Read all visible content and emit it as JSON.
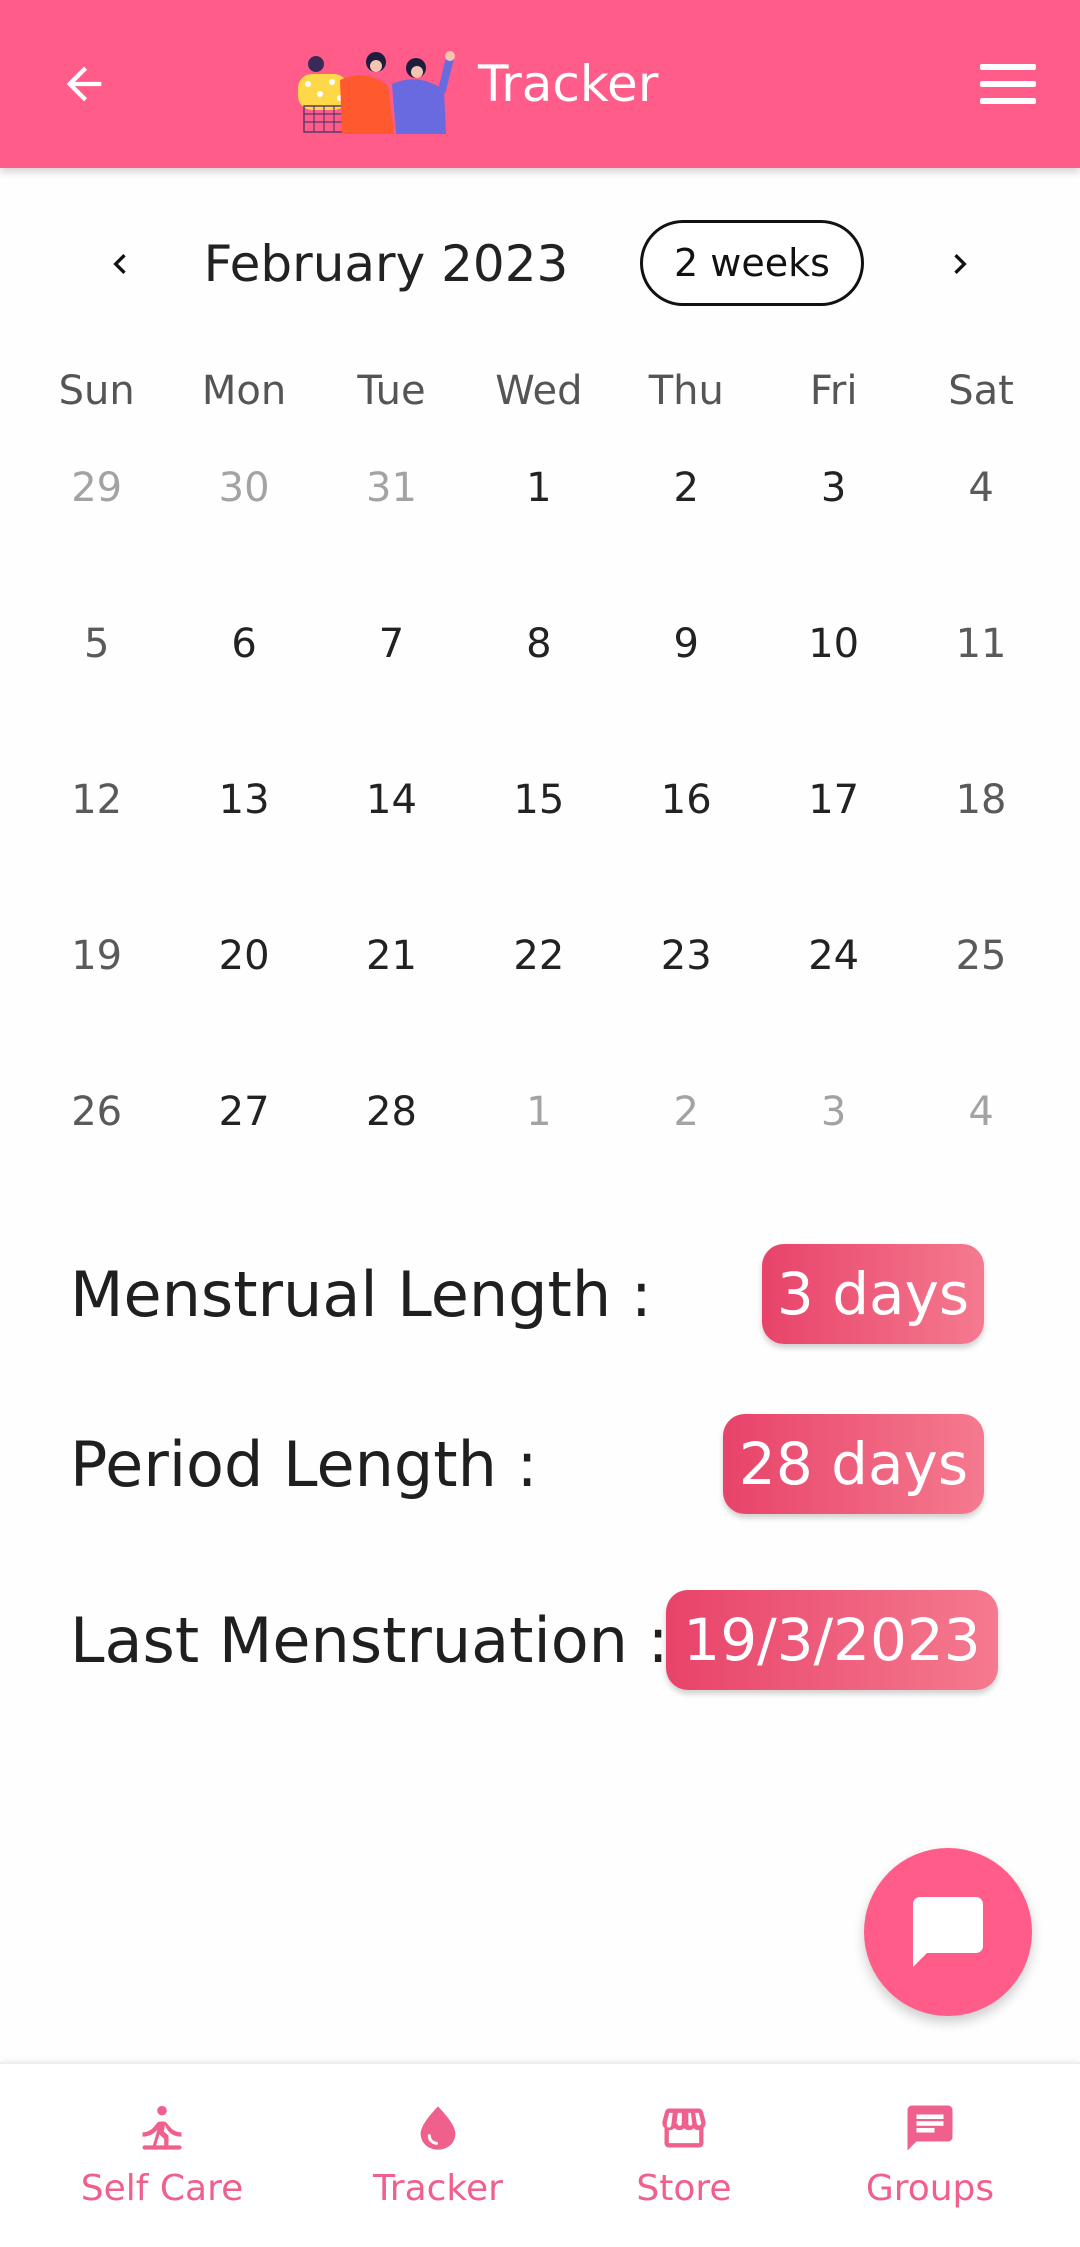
{
  "appbar": {
    "title": "Tracker",
    "back_icon": "arrow-left-icon",
    "menu_icon": "hamburger-menu-icon"
  },
  "calendar": {
    "month_label": "February 2023",
    "mode_label": "2 weeks",
    "weekdays": [
      "Sun",
      "Mon",
      "Tue",
      "Wed",
      "Thu",
      "Fri",
      "Sat"
    ],
    "weeks": [
      [
        {
          "d": "29",
          "out": true
        },
        {
          "d": "30",
          "out": true
        },
        {
          "d": "31",
          "out": true
        },
        {
          "d": "1"
        },
        {
          "d": "2"
        },
        {
          "d": "3"
        },
        {
          "d": "4"
        }
      ],
      [
        {
          "d": "5"
        },
        {
          "d": "6"
        },
        {
          "d": "7"
        },
        {
          "d": "8"
        },
        {
          "d": "9"
        },
        {
          "d": "10"
        },
        {
          "d": "11"
        }
      ],
      [
        {
          "d": "12"
        },
        {
          "d": "13"
        },
        {
          "d": "14"
        },
        {
          "d": "15"
        },
        {
          "d": "16"
        },
        {
          "d": "17"
        },
        {
          "d": "18"
        }
      ],
      [
        {
          "d": "19"
        },
        {
          "d": "20"
        },
        {
          "d": "21"
        },
        {
          "d": "22"
        },
        {
          "d": "23"
        },
        {
          "d": "24"
        },
        {
          "d": "25"
        }
      ],
      [
        {
          "d": "26"
        },
        {
          "d": "27"
        },
        {
          "d": "28"
        },
        {
          "d": "1",
          "out": true
        },
        {
          "d": "2",
          "out": true
        },
        {
          "d": "3",
          "out": true
        },
        {
          "d": "4",
          "out": true
        }
      ]
    ]
  },
  "stats": {
    "menstrual": {
      "label": "Menstrual Length :",
      "value": "3 days"
    },
    "period": {
      "label": "Period Length :",
      "value": "28 days"
    },
    "last": {
      "label": "Last Menstruation :",
      "value": "19/3/2023"
    }
  },
  "fab": {
    "icon": "chat-bubble-icon"
  },
  "bottom_nav": [
    {
      "label": "Self Care",
      "icon": "meditation-icon"
    },
    {
      "label": "Tracker",
      "icon": "drop-icon"
    },
    {
      "label": "Store",
      "icon": "storefront-icon"
    },
    {
      "label": "Groups",
      "icon": "message-icon"
    }
  ],
  "colors": {
    "primary": "#ff5c8a",
    "pill_start": "#e8436a",
    "pill_end": "#f57a8f",
    "nav_text": "#f0608c"
  }
}
